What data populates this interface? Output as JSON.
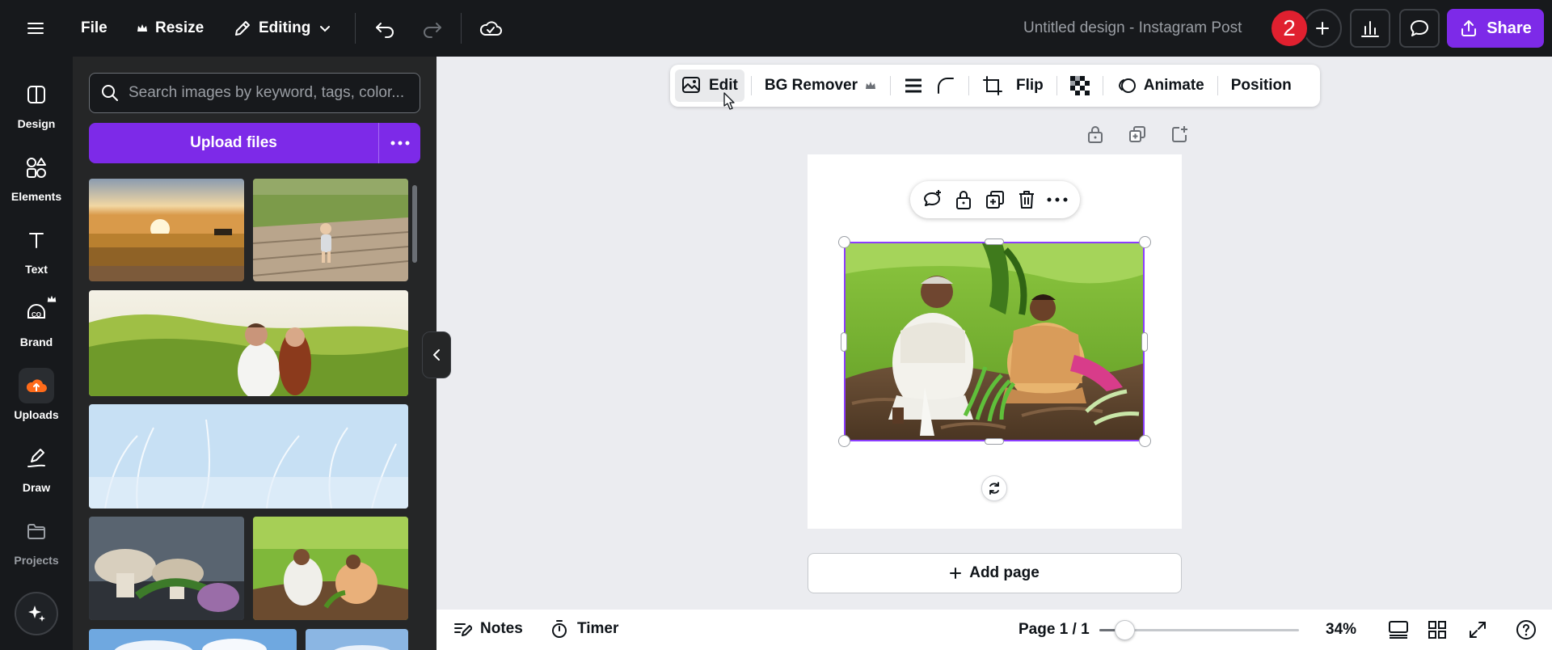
{
  "topbar": {
    "file_label": "File",
    "resize_label": "Resize",
    "editing_label": "Editing",
    "document_title": "Untitled design - Instagram Post",
    "avatar_text": "2",
    "share_label": "Share"
  },
  "rail": {
    "items": [
      {
        "label": "Design",
        "icon": "layout-icon"
      },
      {
        "label": "Elements",
        "icon": "shapes-icon"
      },
      {
        "label": "Text",
        "icon": "text-icon"
      },
      {
        "label": "Brand",
        "icon": "brand-icon"
      },
      {
        "label": "Uploads",
        "icon": "cloud-upload-icon"
      },
      {
        "label": "Draw",
        "icon": "pen-icon"
      },
      {
        "label": "Projects",
        "icon": "folder-icon"
      }
    ]
  },
  "panel": {
    "search_placeholder": "Search images by keyword, tags, color...",
    "upload_label": "Upload files"
  },
  "context_toolbar": {
    "edit_label": "Edit",
    "bg_remover_label": "BG Remover",
    "flip_label": "Flip",
    "animate_label": "Animate",
    "position_label": "Position"
  },
  "canvas": {
    "add_page_label": "Add page"
  },
  "bottombar": {
    "notes_label": "Notes",
    "timer_label": "Timer",
    "page_indicator": "Page 1 / 1",
    "zoom_label": "34%",
    "zoom_fraction": 0.34
  },
  "colors": {
    "brand_purple": "#7d2ae8",
    "selection_purple": "#8b3dff",
    "dark_chrome": "#17191c",
    "panel_bg": "#252627",
    "collab_red": "#e0202f"
  }
}
